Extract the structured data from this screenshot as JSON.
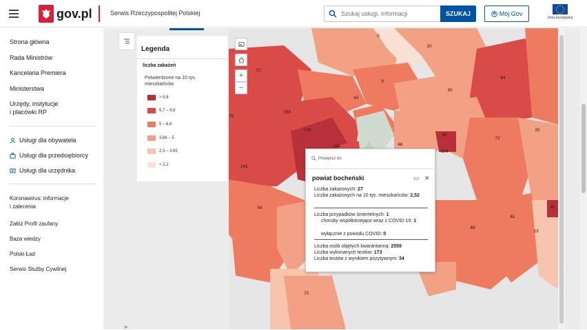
{
  "header": {
    "brand": "gov.pl",
    "service": "Serwis Rzeczypospolitej Polskiej",
    "search_placeholder": "Szukaj usługi, informacji",
    "search_button": "SZUKAJ",
    "my_gov": "Mój Gov",
    "eu_label": "Unia Europejska"
  },
  "sidebar": {
    "items": [
      "Strona główna",
      "Rada Ministrów",
      "Kancelaria Premiera",
      "Ministerstwa",
      "Urzędy, instytucje",
      "i placówki RP"
    ],
    "services": [
      "Usługi dla obywatela",
      "Usługi dla przedsiębiorcy",
      "Usługi dla urzędnika"
    ],
    "links": [
      "Koronawirus: informacje",
      "i zalecenia",
      "Załóż Profil zaufany",
      "Baza wiedzy",
      "Polski Ład",
      "Serwis Służby Cywilnej"
    ]
  },
  "legend": {
    "title": "Legenda",
    "subtitle": "liczba zakażeń",
    "description": "Potwierdzone na 10 tys. mieszkańców",
    "classes": [
      {
        "label": "> 9,8",
        "color": "#b8313a"
      },
      {
        "label": "6,7 – 9,8",
        "color": "#d84b47"
      },
      {
        "label": "5 – 6,6",
        "color": "#ee7a5f"
      },
      {
        "label": "3,66 – 5",
        "color": "#f3a184"
      },
      {
        "label": "2,3 – 3,65",
        "color": "#f7c4ad"
      },
      {
        "label": "< 2,2",
        "color": "#fae1d5"
      }
    ]
  },
  "map_labels": [
    "5",
    "20",
    "77",
    "9",
    "30",
    "94",
    "42",
    "250",
    "719",
    "114",
    "46",
    "34",
    "100",
    "72",
    "25",
    "75",
    "145",
    "54",
    "48",
    "61",
    "32",
    "23",
    "21"
  ],
  "popup": {
    "zoom": "Powiększ do",
    "title": "powiat bocheński",
    "cases_label": "Liczba zakażonych:",
    "cases": "27",
    "per10k_label": "Liczba zakażonych na 10 tys. mieszkańców:",
    "per10k": "2,52",
    "deaths_label": "Liczba przypadków śmiertelnych:",
    "deaths": "1",
    "comorb_label": "choroby współistniejące wraz z COVID-19:",
    "comorb": "1",
    "covid_only_label": "wyłącznie z powodu COVID:",
    "covid_only": "0",
    "quarantine_label": "Liczba osób objętych kwarantanną:",
    "quarantine": "2559",
    "tests_label": "Liczba wykonanych testów:",
    "tests": "173",
    "positive_label": "Liczba testów z wynikiem pozytywnym:",
    "positive": "34"
  }
}
